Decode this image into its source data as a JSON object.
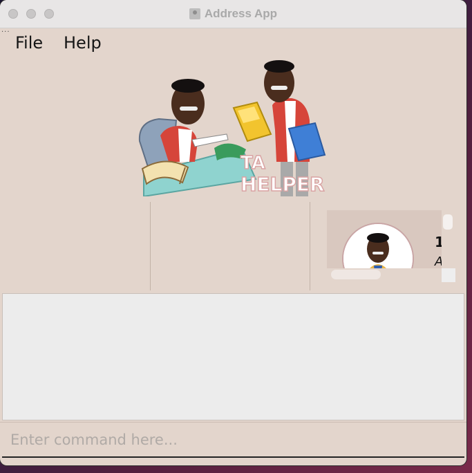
{
  "window": {
    "title": "Address App"
  },
  "menu": {
    "items": [
      "File",
      "Help"
    ],
    "overflow": "..."
  },
  "banner": {
    "logo_text_line1": "TA",
    "logo_text_line2": "HELPER"
  },
  "person_card": {
    "index_text": "1",
    "name_text": "A"
  },
  "command_box": {
    "placeholder": "Enter command here..."
  },
  "colors": {
    "window_bg": "#e3d5cc",
    "result_bg": "#ececec",
    "titlebar": "#e8e6e6"
  }
}
